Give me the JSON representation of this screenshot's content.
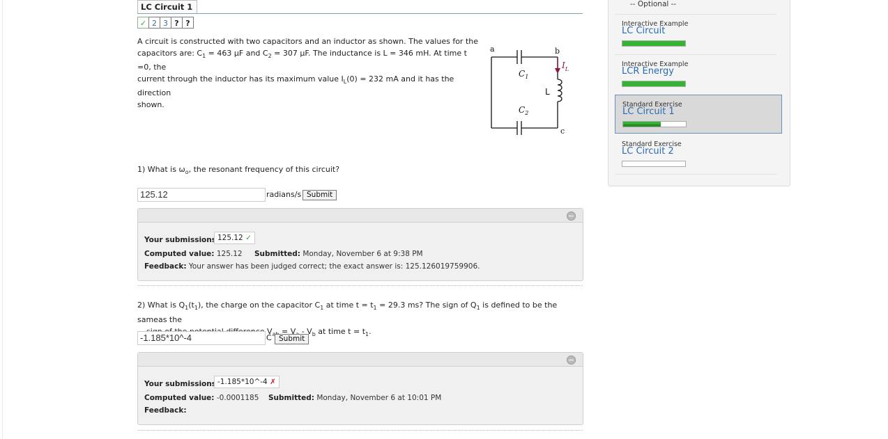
{
  "title": "LC Circuit 1",
  "parts": [
    "✓",
    "2",
    "3",
    "?",
    "?"
  ],
  "problem": {
    "t1": "A circuit is constructed with two capacitors and an inductor as shown. The values for the",
    "t2a": "capacitors are: C",
    "t2b": " = 463 μF and C",
    "t2c": " = 307 μF. The inductance is L = 346 mH. At time t =0, the",
    "t3a": "current through the inductor has its maximum value I",
    "t3b": "(0) = 232 mA and it has the direction",
    "t4": "shown.",
    "sub1": "1",
    "sub2": "2",
    "subL": "L"
  },
  "circuit": {
    "a": "a",
    "b": "b",
    "c": "c",
    "C1": "C",
    "C2": "C",
    "s1": "1",
    "s2": "2",
    "L": "L",
    "IL": "I",
    "ILsub": "L"
  },
  "q1": {
    "text_a": "1) What is ω",
    "text_sub": "o",
    "text_b": ", the resonant frequency of this circuit?",
    "answer": "125.12",
    "unit": "radians/s",
    "submit": "Submit",
    "your_submissions_label": "Your submissions:",
    "submission": "125.12",
    "computed_label": "Computed value:",
    "computed": "125.12",
    "submitted_label": "Submitted:",
    "submitted": "Monday, November 6 at 9:38 PM",
    "feedback_label": "Feedback:",
    "feedback": "Your answer has been judged correct; the exact answer is: 125.126019759906."
  },
  "q2": {
    "l1a": "2) What is Q",
    "l1b": "(t",
    "l1c": "), the charge on the capacitor C",
    "l1d": " at time t = t",
    "l1e": " = 29.3 ms? The sign of Q",
    "l1f": " is defined to be the sameas the",
    "one": "1",
    "l2a": "sign of the potential difference V",
    "l2sub_ab": "ab",
    "l2b": " = V",
    "l2sub_a": "a",
    "l2c": " - V",
    "l2sub_b": "b",
    "l2d": " at time t = t",
    "l2e": ".",
    "answer": "-1.185*10^-4",
    "unit": "C",
    "submit": "Submit",
    "your_submissions_label": "Your submissions:",
    "submission": "-1.185*10^-4",
    "computed_label": "Computed value:",
    "computed": "-0.0001185",
    "submitted_label": "Submitted:",
    "submitted": "Monday, November 6 at 10:01 PM",
    "feedback_label": "Feedback:"
  },
  "sidebar": {
    "optional": "-- Optional --",
    "items": [
      {
        "type": "Interactive Example",
        "name": "LC Circuit",
        "progress": 1.0
      },
      {
        "type": "Interactive Example",
        "name": "LCR Energy",
        "progress": 1.0
      },
      {
        "type": "Standard Exercise",
        "name": "LC Circuit 1",
        "progress": 0.6
      },
      {
        "type": "Standard Exercise",
        "name": "LC Circuit 2",
        "progress": 0.0
      }
    ]
  },
  "colors": {
    "accent": "#2a6ab3",
    "success": "#33b533",
    "error": "#d02020"
  }
}
